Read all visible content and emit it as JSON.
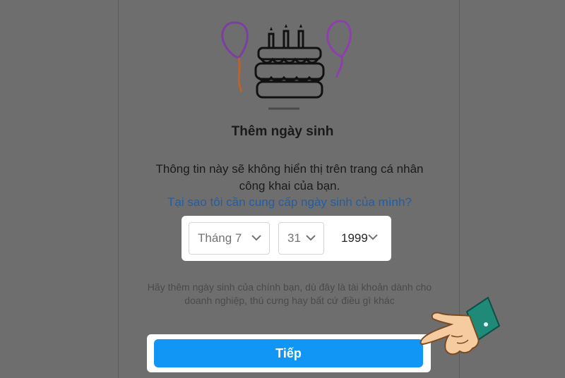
{
  "dialog": {
    "title": "Thêm ngày sinh",
    "description": "Thông tin này sẽ không hiển thị trên trang cá nhân công khai của bạn.",
    "why_link": "Tại sao tôi cần cung cấp ngày sinh của mình?",
    "note": "Hãy thêm ngày sinh của chính bạn, dù đây là tài khoản dành cho doanh nghiệp, thú cưng hay bất cứ điều gì khác",
    "next_button": "Tiếp"
  },
  "birthday": {
    "month": "Tháng 7",
    "day": "31",
    "year": "1999"
  },
  "icons": {
    "illustration": "birthday-cake-balloons-icon",
    "dropdown": "chevron-down-icon",
    "pointer": "pointing-hand-icon"
  },
  "colors": {
    "button": "#1196f5",
    "link": "#1f5fa8",
    "overlay": "#6e6e6e"
  }
}
